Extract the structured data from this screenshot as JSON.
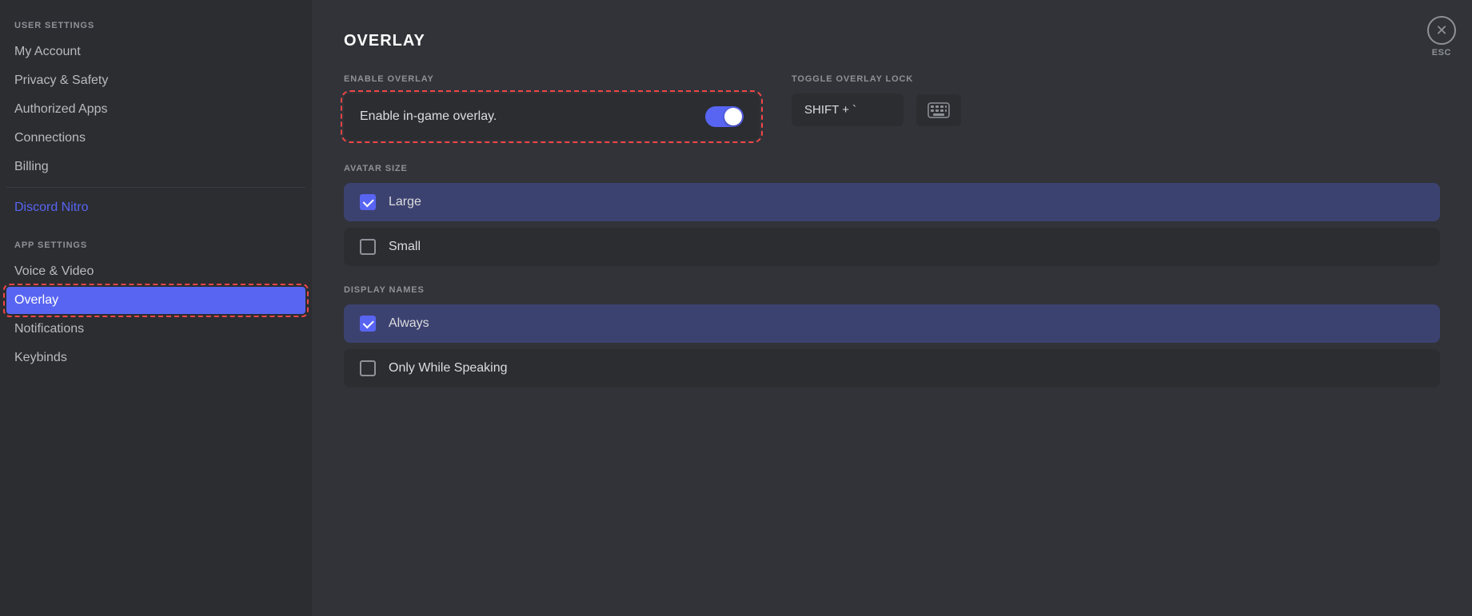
{
  "sidebar": {
    "userSettingsLabel": "USER SETTINGS",
    "appSettingsLabel": "APP SETTINGS",
    "items": [
      {
        "id": "my-account",
        "label": "My Account",
        "active": false,
        "nitro": false
      },
      {
        "id": "privacy-safety",
        "label": "Privacy & Safety",
        "active": false,
        "nitro": false
      },
      {
        "id": "authorized-apps",
        "label": "Authorized Apps",
        "active": false,
        "nitro": false
      },
      {
        "id": "connections",
        "label": "Connections",
        "active": false,
        "nitro": false
      },
      {
        "id": "billing",
        "label": "Billing",
        "active": false,
        "nitro": false
      },
      {
        "id": "discord-nitro",
        "label": "Discord Nitro",
        "active": false,
        "nitro": true
      },
      {
        "id": "voice-video",
        "label": "Voice & Video",
        "active": false,
        "nitro": false
      },
      {
        "id": "overlay",
        "label": "Overlay",
        "active": true,
        "nitro": false
      },
      {
        "id": "notifications",
        "label": "Notifications",
        "active": false,
        "nitro": false
      },
      {
        "id": "keybinds",
        "label": "Keybinds",
        "active": false,
        "nitro": false
      }
    ]
  },
  "main": {
    "pageTitle": "OVERLAY",
    "enableOverlay": {
      "sectionLabel": "ENABLE OVERLAY",
      "toggleLabel": "Enable in-game overlay.",
      "toggleEnabled": true
    },
    "toggleOverlayLock": {
      "sectionLabel": "TOGGLE OVERLAY LOCK",
      "keybind": "SHIFT + `"
    },
    "avatarSize": {
      "sectionLabel": "AVATAR SIZE",
      "options": [
        {
          "id": "large",
          "label": "Large",
          "selected": true
        },
        {
          "id": "small",
          "label": "Small",
          "selected": false
        }
      ]
    },
    "displayNames": {
      "sectionLabel": "DISPLAY NAMES",
      "options": [
        {
          "id": "always",
          "label": "Always",
          "selected": true
        },
        {
          "id": "only-while-speaking",
          "label": "Only While Speaking",
          "selected": false
        }
      ]
    }
  },
  "closeButton": {
    "label": "✕",
    "escLabel": "ESC"
  }
}
